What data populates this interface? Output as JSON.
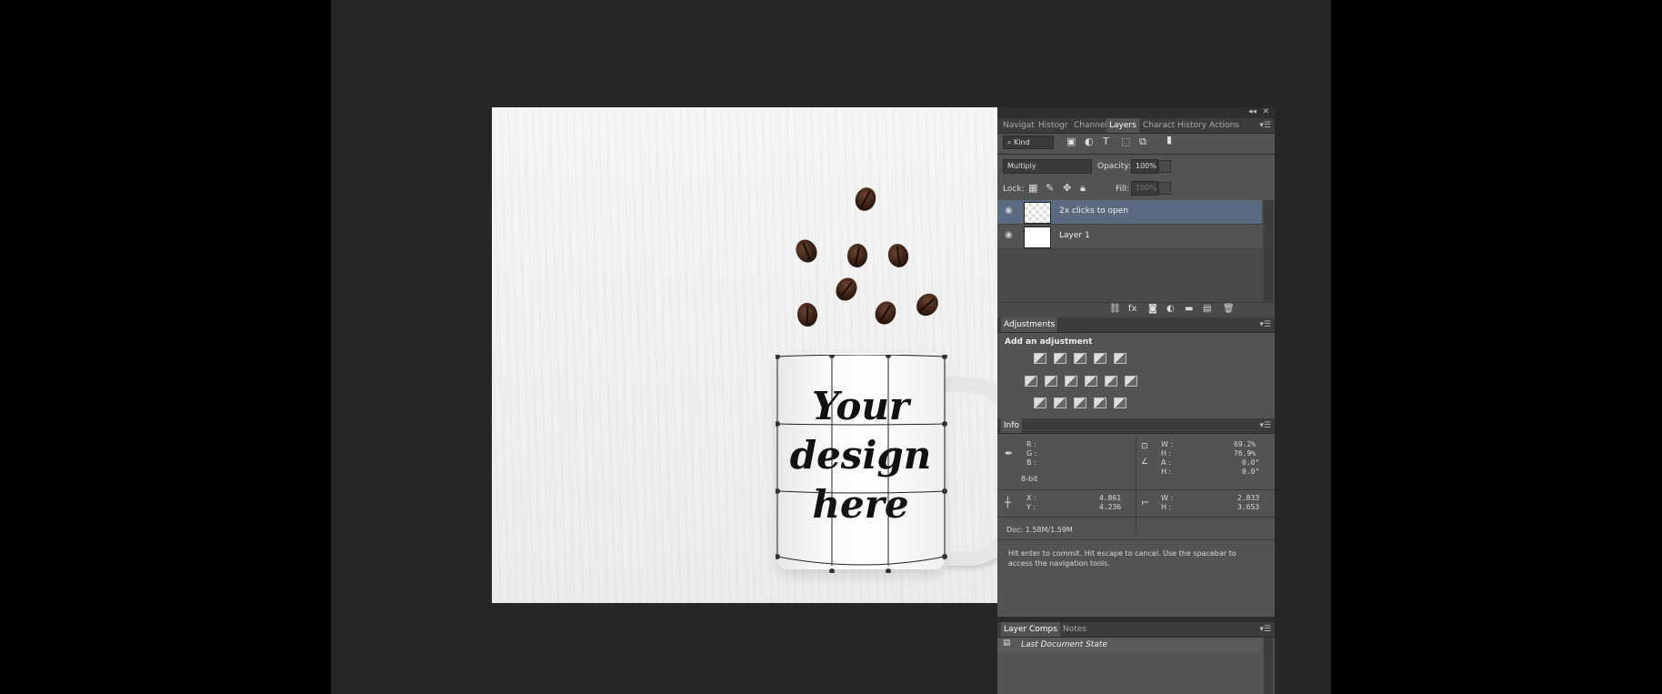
{
  "layers_panel": {
    "tabs": [
      "Navigat",
      "Histogr",
      "Channel",
      "Layers",
      "Charact",
      "History",
      "Actions"
    ],
    "active_tab": "Layers",
    "filter_kind": "Kind",
    "blend_mode": "Multiply",
    "opacity_label": "Opacity:",
    "opacity_value": "100%",
    "lock_label": "Lock:",
    "fill_label": "Fill:",
    "fill_value": "100%",
    "layers": [
      {
        "name": "2x clicks to open",
        "selected": true
      },
      {
        "name": "Layer 1",
        "selected": false
      }
    ],
    "footer_icons": [
      "link-icon",
      "fx-icon",
      "mask-icon",
      "adjustment-layer-icon",
      "folder-icon",
      "new-layer-icon",
      "trash-icon"
    ]
  },
  "adjustments_panel": {
    "tab": "Adjustments",
    "heading": "Add an adjustment"
  },
  "info_panel": {
    "tab": "Info",
    "r_label": "R :",
    "g_label": "G :",
    "b_label": "B :",
    "bit_depth": "8-bit",
    "w1_label": "W :",
    "w1_value": "69.2%",
    "h1_label": "H :",
    "h1_value": "76.9%",
    "a_label": "A :",
    "a_value": "0.0°",
    "h2_label": "H :",
    "h2_value": "0.0°",
    "x_label": "X :",
    "x_value": "4.861",
    "y_label": "Y :",
    "y_value": "4.236",
    "w2_label": "W :",
    "w2_value": "2.833",
    "h3_label": "H :",
    "h3_value": "3.653",
    "doc": "Doc: 1.58M/1.59M",
    "hint": "Hit enter to commit. Hit escape to cancel. Use the spacebar to access the navigation tools."
  },
  "comps_panel": {
    "tabs": [
      "Layer Comps",
      "Notes"
    ],
    "item": "Last Document State"
  },
  "canvas": {
    "design_lines": [
      "Your",
      "design",
      "here"
    ]
  }
}
